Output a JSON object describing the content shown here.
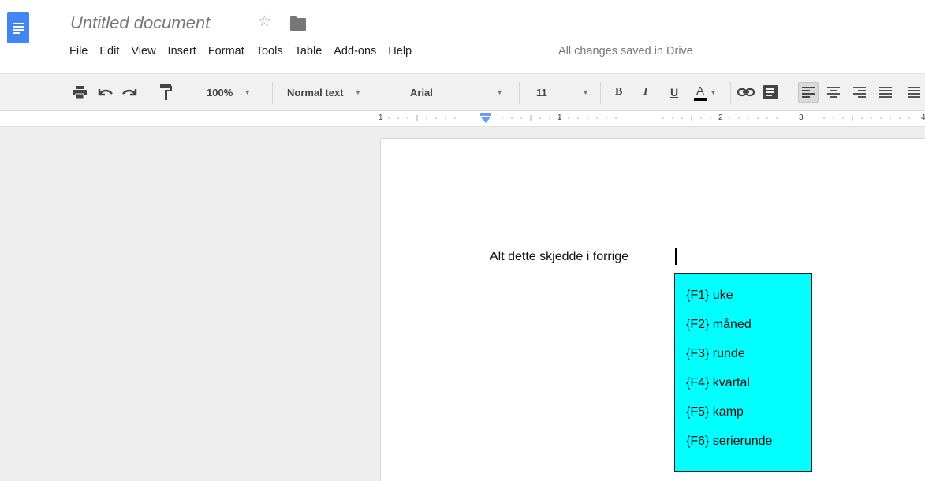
{
  "header": {
    "title": "Untitled document",
    "save_status": "All changes saved in Drive"
  },
  "menu": [
    "File",
    "Edit",
    "View",
    "Insert",
    "Format",
    "Tools",
    "Table",
    "Add-ons",
    "Help"
  ],
  "toolbar": {
    "zoom": "100%",
    "style": "Normal text",
    "font": "Arial",
    "size": "11",
    "bold": "B",
    "italic": "I",
    "underline": "U",
    "text_color": "A"
  },
  "ruler": {
    "labels": [
      "1",
      "1",
      "2",
      "3",
      "4"
    ]
  },
  "document": {
    "text": "Alt dette skjedde i forrige"
  },
  "suggestions": [
    {
      "label": "{F1} uke"
    },
    {
      "label": "{F2} måned"
    },
    {
      "label": "{F3} runde"
    },
    {
      "label": "{F4} kvartal"
    },
    {
      "label": "{F5} kamp"
    },
    {
      "label": "{F6} serierunde"
    }
  ],
  "colors": {
    "logo": "#4285f4",
    "popup_bg": "#00ffff",
    "toolbar_bg": "#f1f1f1",
    "canvas_bg": "#eeeeee"
  }
}
